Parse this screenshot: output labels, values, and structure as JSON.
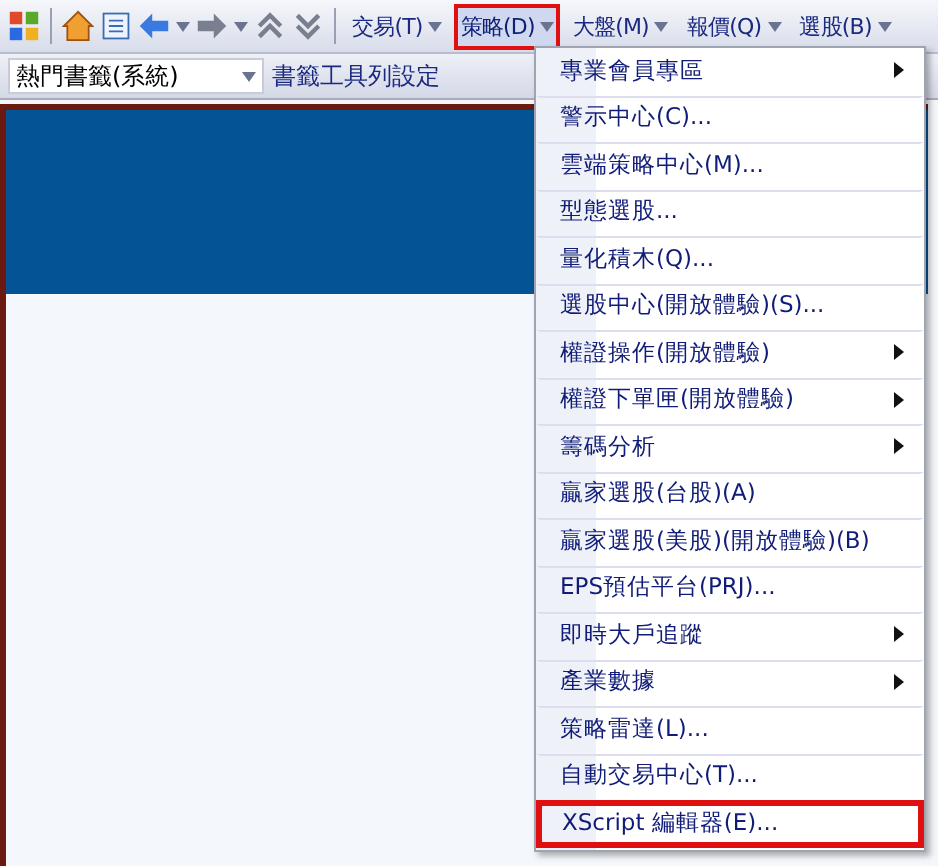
{
  "menu_bar": {
    "items": [
      {
        "label": "交易(T)",
        "selected": false,
        "highlighted": false
      },
      {
        "label": "策略(D)",
        "selected": true,
        "highlighted": true
      },
      {
        "label": "大盤(M)",
        "selected": false,
        "highlighted": false
      },
      {
        "label": "報價(Q)",
        "selected": false,
        "highlighted": false
      },
      {
        "label": "選股(B)",
        "selected": false,
        "highlighted": false
      }
    ]
  },
  "bookmark_bar": {
    "dropdown": "熱門書籤(系統)",
    "settings": "書籤工具列設定"
  },
  "dropdown_menu": {
    "items": [
      {
        "label": "專業會員專區",
        "submenu": true,
        "highlighted": false
      },
      {
        "label": "警示中心(C)...",
        "submenu": false,
        "highlighted": false
      },
      {
        "label": "雲端策略中心(M)...",
        "submenu": false,
        "highlighted": false
      },
      {
        "label": "型態選股...",
        "submenu": false,
        "highlighted": false
      },
      {
        "label": "量化積木(Q)...",
        "submenu": false,
        "highlighted": false
      },
      {
        "label": "選股中心(開放體驗)(S)...",
        "submenu": false,
        "highlighted": false
      },
      {
        "label": "權證操作(開放體驗)",
        "submenu": true,
        "highlighted": false
      },
      {
        "label": "權證下單匣(開放體驗)",
        "submenu": true,
        "highlighted": false
      },
      {
        "label": "籌碼分析",
        "submenu": true,
        "highlighted": false
      },
      {
        "label": "贏家選股(台股)(A)",
        "submenu": false,
        "highlighted": false
      },
      {
        "label": "贏家選股(美股)(開放體驗)(B)",
        "submenu": false,
        "highlighted": false
      },
      {
        "label": "EPS預估平台(PRJ)...",
        "submenu": false,
        "highlighted": false
      },
      {
        "label": "即時大戶追蹤",
        "submenu": true,
        "highlighted": false
      },
      {
        "label": "產業數據",
        "submenu": true,
        "highlighted": false
      },
      {
        "label": "策略雷達(L)...",
        "submenu": false,
        "highlighted": false
      },
      {
        "label": "自動交易中心(T)...",
        "submenu": false,
        "highlighted": false
      },
      {
        "label": "XScript 編輯器(E)...",
        "submenu": false,
        "highlighted": true
      }
    ]
  }
}
